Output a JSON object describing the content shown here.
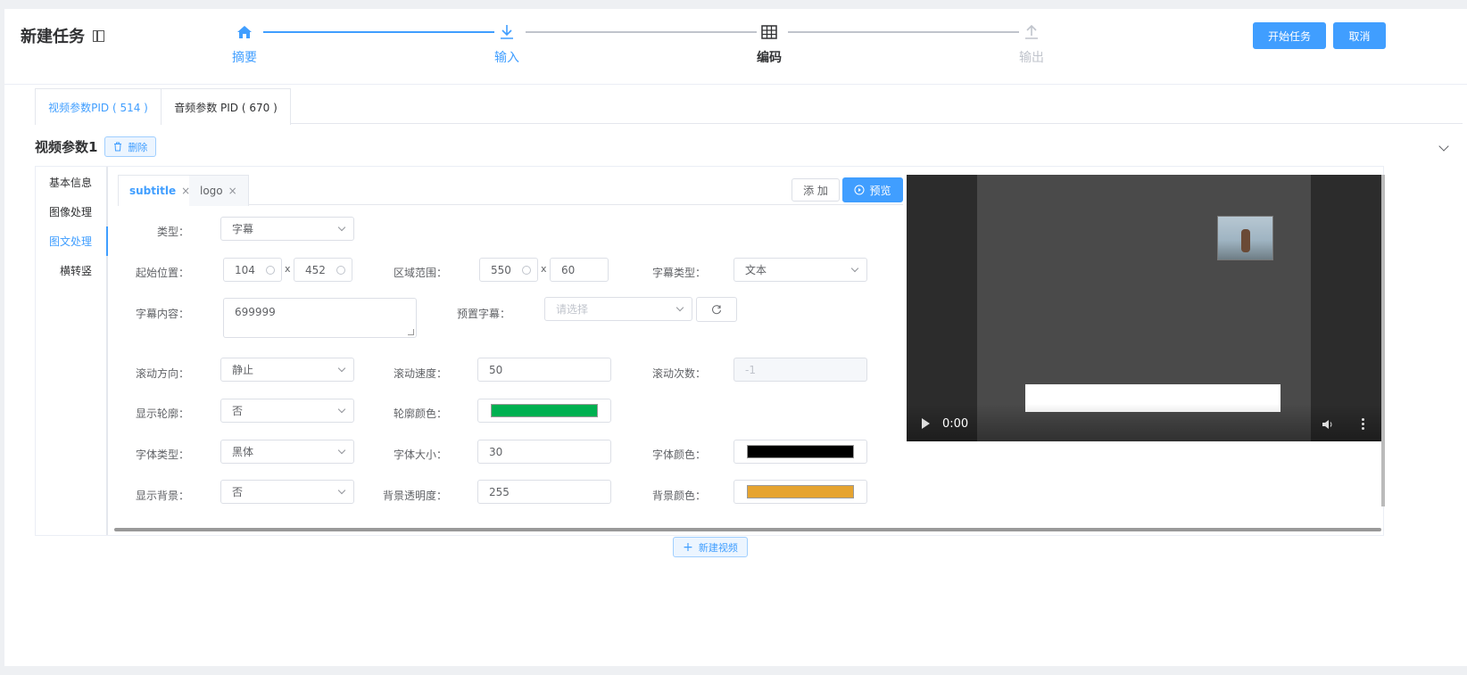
{
  "header": {
    "title": "新建任务",
    "start_label": "开始任务",
    "cancel_label": "取消"
  },
  "steps": [
    {
      "label": "摘要",
      "icon": "home-icon",
      "state": "done"
    },
    {
      "label": "输入",
      "icon": "download-icon",
      "state": "done"
    },
    {
      "label": "编码",
      "icon": "table-icon",
      "state": "active"
    },
    {
      "label": "输出",
      "icon": "upload-icon",
      "state": "pending"
    }
  ],
  "pid_tabs": [
    {
      "label": "视频参数PID ( 514 )",
      "active": true
    },
    {
      "label": "音频参数 PID ( 670 )",
      "active": false
    }
  ],
  "section": {
    "title": "视频参数1",
    "delete_label": "删除"
  },
  "side_nav": [
    {
      "label": "基本信息",
      "active": false
    },
    {
      "label": "图像处理",
      "active": false
    },
    {
      "label": "图文处理",
      "active": true
    },
    {
      "label": "横转竖",
      "active": false
    }
  ],
  "content_tabs": [
    {
      "label": "subtitle",
      "active": true
    },
    {
      "label": "logo",
      "active": false
    }
  ],
  "actions": {
    "add_label": "添 加",
    "preview_label": "预览"
  },
  "form": {
    "type_label": "类型：",
    "type_value": "字幕",
    "start_pos_label": "起始位置：",
    "start_x": "104",
    "start_y": "452",
    "x_sep": "x",
    "area_label": "区域范围：",
    "area_w": "550",
    "area_h": "60",
    "sub_type_label": "字幕类型：",
    "sub_type_value": "文本",
    "content_label": "字幕内容：",
    "content_value": "699999",
    "preset_label": "预置字幕：",
    "preset_placeholder": "请选择",
    "scroll_dir_label": "滚动方向：",
    "scroll_dir_value": "静止",
    "scroll_speed_label": "滚动速度：",
    "scroll_speed_value": "50",
    "scroll_count_label": "滚动次数：",
    "scroll_count_value": "-1",
    "outline_label": "显示轮廓：",
    "outline_value": "否",
    "outline_color_label": "轮廓颜色：",
    "outline_color": "#00b050",
    "font_type_label": "字体类型：",
    "font_type_value": "黑体",
    "font_size_label": "字体大小：",
    "font_size_value": "30",
    "font_color_label": "字体颜色：",
    "font_color": "#000000",
    "bg_label": "显示背景：",
    "bg_value": "否",
    "bg_alpha_label": "背景透明度：",
    "bg_alpha_value": "255",
    "bg_color_label": "背景颜色：",
    "bg_color": "#e6a430"
  },
  "video": {
    "time": "0:00"
  },
  "new_video_label": "新建视频",
  "colors": {
    "accent": "#409eff",
    "pending": "#c0c4cc"
  }
}
